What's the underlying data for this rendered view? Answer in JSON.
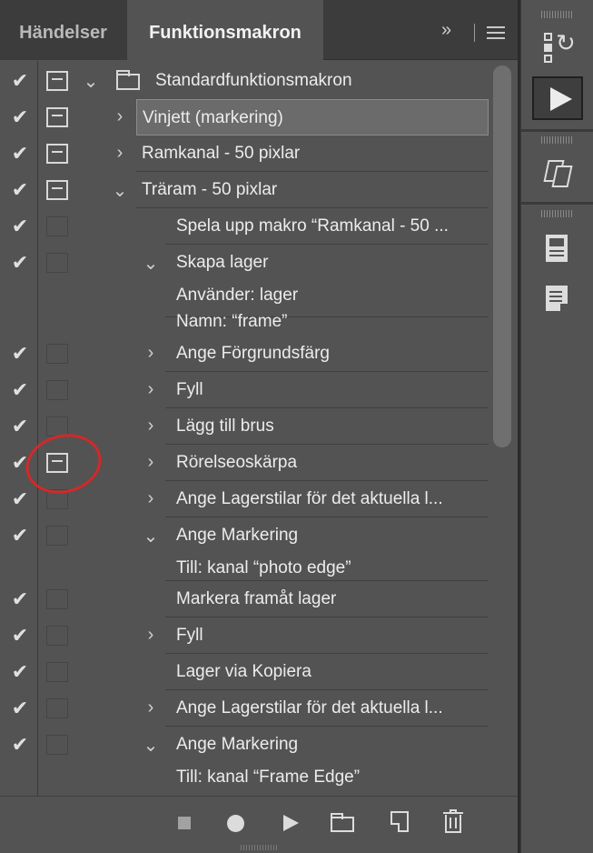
{
  "tabs": [
    {
      "label": "Händelser",
      "active": false
    },
    {
      "label": "Funktionsmakron",
      "active": true
    }
  ],
  "panel_controls": {
    "collapse_glyph": "»",
    "menu_icon": "hamburger-icon"
  },
  "rows": [
    {
      "label": "Standardfunktionsmakron"
    },
    {
      "label": "Vinjett (markering)"
    },
    {
      "label": "Ramkanal - 50 pixlar"
    },
    {
      "label": "Träram - 50 pixlar"
    },
    {
      "label": "Spela upp makro “Ramkanal - 50 ..."
    },
    {
      "label": "Skapa lager",
      "details": [
        "Använder: lager",
        "Namn:  “frame”"
      ]
    },
    {
      "label": "Ange Förgrundsfärg"
    },
    {
      "label": "Fyll"
    },
    {
      "label": "Lägg till brus"
    },
    {
      "label": "Rörelseoskärpa"
    },
    {
      "label": "Ange Lagerstilar för det aktuella l..."
    },
    {
      "label": "Ange Markering",
      "details": [
        "Till: kanal “photo edge”"
      ]
    },
    {
      "label": "Markera framåt lager"
    },
    {
      "label": "Fyll"
    },
    {
      "label": "Lager via Kopiera"
    },
    {
      "label": "Ange Lagerstilar för det aktuella l..."
    },
    {
      "label": "Ange Markering",
      "details": [
        "Till: kanal “Frame Edge”"
      ]
    }
  ],
  "glyphs": {
    "check": "✔",
    "expand": "›",
    "collapse": "⌄"
  },
  "colors": {
    "panel": "#535353",
    "tabbar": "#3c3c3c",
    "selection": "#6b6b6b",
    "annotation": "#d42828"
  },
  "toolbar_icons": [
    "stop-icon",
    "record-icon",
    "play-icon",
    "new-set-icon",
    "new-action-icon",
    "trash-icon"
  ],
  "dock_icons": [
    "history-icon",
    "actions-icon",
    "clone-source-icon",
    "properties-icon",
    "notes-icon"
  ]
}
